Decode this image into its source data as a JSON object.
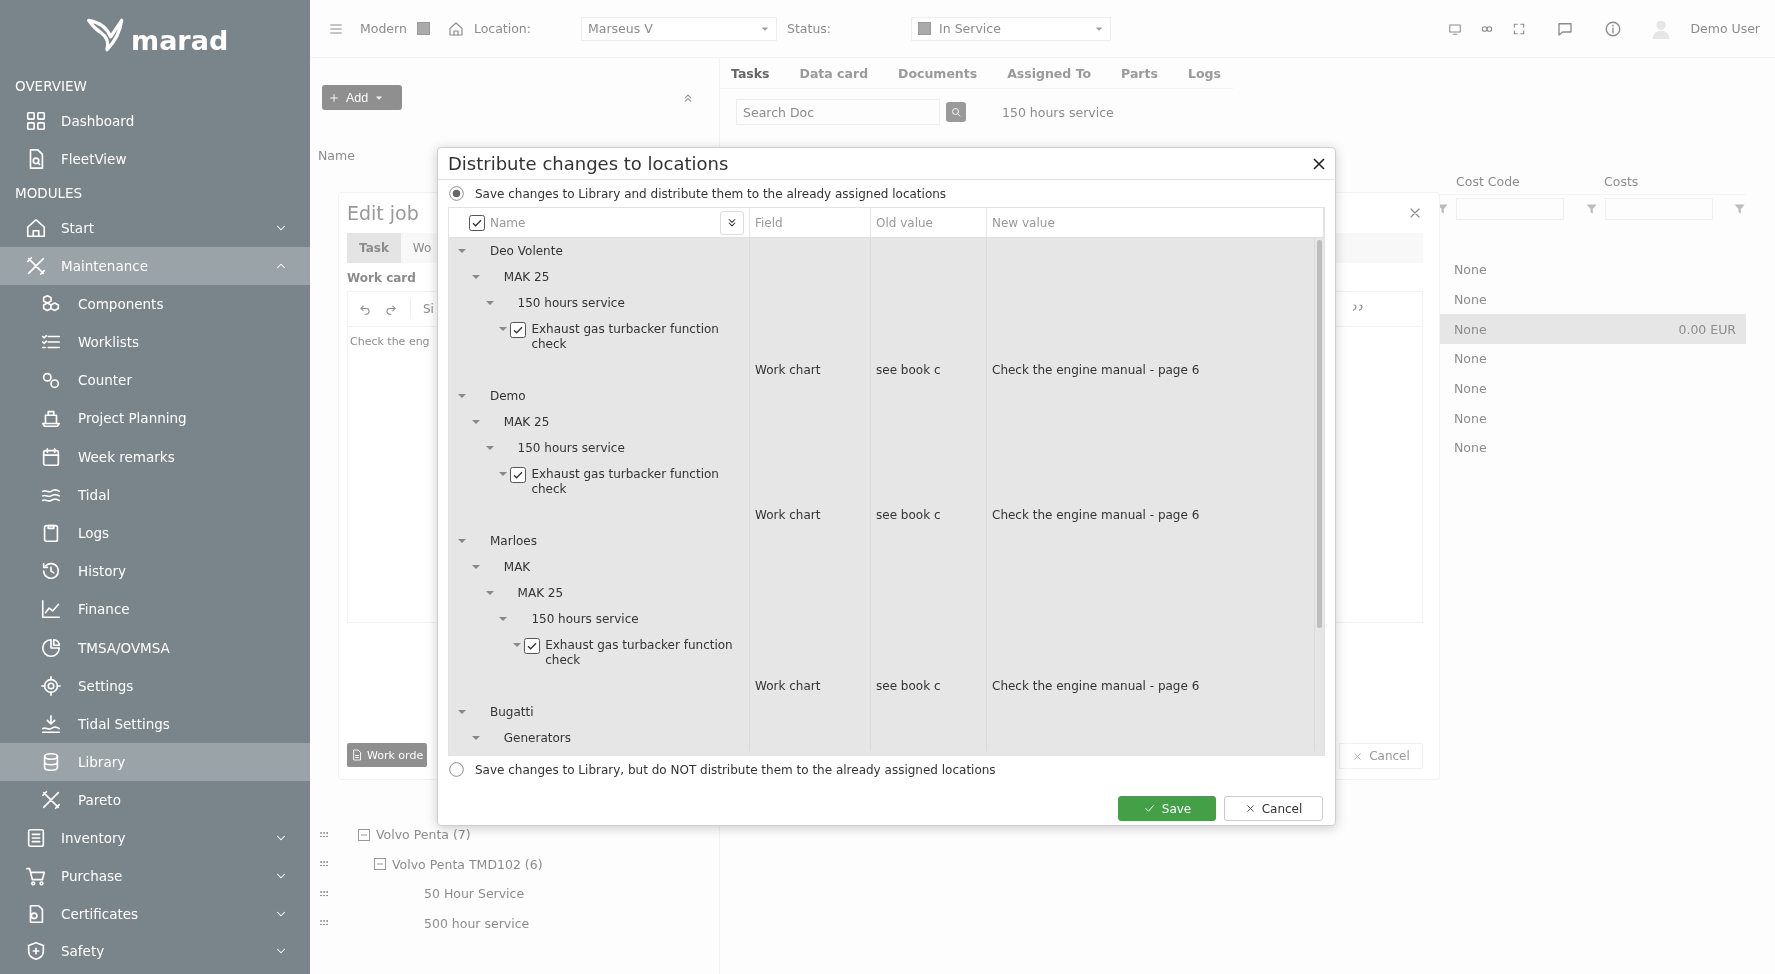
{
  "sidebar": {
    "logo": "marad",
    "sections": [
      {
        "title": "OVERVIEW",
        "items": [
          {
            "label": "Dashboard",
            "selected": false
          },
          {
            "label": "FleetView",
            "selected": false
          }
        ]
      },
      {
        "title": "MODULES",
        "items": [
          {
            "label": "Start",
            "selected": false,
            "expanded": false
          },
          {
            "label": "Maintenance",
            "selected": true,
            "expanded": true,
            "children": [
              {
                "label": "Components",
                "selected": false
              },
              {
                "label": "Worklists",
                "selected": false
              },
              {
                "label": "Counter",
                "selected": false
              },
              {
                "label": "Project Planning",
                "selected": false
              },
              {
                "label": "Week remarks",
                "selected": false
              },
              {
                "label": "Tidal",
                "selected": false
              },
              {
                "label": "Logs",
                "selected": false
              },
              {
                "label": "History",
                "selected": false
              },
              {
                "label": "Finance",
                "selected": false
              },
              {
                "label": "TMSA/OVMSA",
                "selected": false
              },
              {
                "label": "Settings",
                "selected": false
              },
              {
                "label": "Tidal Settings",
                "selected": false
              },
              {
                "label": "Library",
                "selected": true
              },
              {
                "label": "Pareto",
                "selected": false
              }
            ]
          },
          {
            "label": "Inventory",
            "selected": false,
            "expanded": false
          },
          {
            "label": "Purchase",
            "selected": false,
            "expanded": false
          },
          {
            "label": "Certificates",
            "selected": false,
            "expanded": false
          },
          {
            "label": "Safety",
            "selected": false,
            "expanded": false
          }
        ]
      }
    ]
  },
  "topbar": {
    "modern_label": "Modern",
    "modern_checked": true,
    "location_label": "Location:",
    "location_value": "Marseus V",
    "status_label": "Status:",
    "status_value": "In Service",
    "user": "Demo User"
  },
  "left_panel": {
    "add_button": "Add",
    "column": "Name",
    "rows": [
      {
        "label": "Volvo Penta (7)",
        "expanded": true,
        "children": [
          {
            "label": "Volvo Penta TMD102 (6)",
            "expanded": true,
            "children": [
              {
                "label": "50 Hour Service"
              },
              {
                "label": "500 hour service"
              }
            ]
          }
        ]
      }
    ]
  },
  "right_panel": {
    "tabs": [
      {
        "label": "Tasks",
        "selected": true
      },
      {
        "label": "Data card",
        "selected": false
      },
      {
        "label": "Documents",
        "selected": false
      },
      {
        "label": "Assigned To",
        "selected": false
      },
      {
        "label": "Parts",
        "selected": false
      },
      {
        "label": "Logs",
        "selected": false
      }
    ],
    "search_placeholder": "Search Doc",
    "breadcrumb": "150 hours service",
    "columns": [
      "Cost Code",
      "Costs"
    ],
    "rows": [
      {
        "cost_code": "None",
        "selected": false
      },
      {
        "cost_code": "None",
        "selected": false
      },
      {
        "cost_code": "None",
        "costs": "0.00 EUR",
        "selected": true
      },
      {
        "cost_code": "None",
        "selected": false
      },
      {
        "cost_code": "None",
        "selected": false
      },
      {
        "cost_code": "None",
        "selected": false
      },
      {
        "cost_code": "None",
        "selected": false
      }
    ]
  },
  "edit_job": {
    "title": "Edit job",
    "tabs": [
      {
        "label": "Task",
        "selected": true
      },
      {
        "label": "Wo",
        "selected": false
      }
    ],
    "section": "Work card",
    "toolbar_text": "Si",
    "content": "Check the eng",
    "buttons": [
      {
        "label": "Work orde",
        "kind": "work-order"
      },
      {
        "label": "Cancel",
        "kind": "cancel"
      }
    ]
  },
  "dialog": {
    "title": "Distribute changes to locations",
    "options": [
      {
        "label": "Save changes to Library and distribute them to the already assigned locations",
        "selected": true
      },
      {
        "label": "Save changes to Library, but do NOT distribute them to the already assigned locations",
        "selected": false
      }
    ],
    "select_all_checked": true,
    "columns": [
      "Name",
      "Field",
      "Old value",
      "New value"
    ],
    "tree": [
      {
        "name": "Deo Volente",
        "expanded": true,
        "children": [
          {
            "name": "MAK 25",
            "expanded": true,
            "children": [
              {
                "name": "150 hours service",
                "expanded": true,
                "children": [
                  {
                    "name": "Exhaust gas turbacker function check",
                    "expanded": true,
                    "checked": true,
                    "changes": [
                      {
                        "field": "Work chart",
                        "old_value": "see book c",
                        "new_value": "Check the engine manual - page 6"
                      }
                    ]
                  }
                ]
              }
            ]
          }
        ]
      },
      {
        "name": "Demo",
        "expanded": true,
        "children": [
          {
            "name": "MAK 25",
            "expanded": true,
            "children": [
              {
                "name": "150 hours service",
                "expanded": true,
                "children": [
                  {
                    "name": "Exhaust gas turbacker function check",
                    "expanded": true,
                    "checked": true,
                    "changes": [
                      {
                        "field": "Work chart",
                        "old_value": "see book c",
                        "new_value": "Check the engine manual - page 6"
                      }
                    ]
                  }
                ]
              }
            ]
          }
        ]
      },
      {
        "name": "Marloes",
        "expanded": true,
        "children": [
          {
            "name": "MAK",
            "expanded": true,
            "children": [
              {
                "name": "MAK 25",
                "expanded": true,
                "children": [
                  {
                    "name": "150 hours service",
                    "expanded": true,
                    "children": [
                      {
                        "name": "Exhaust gas turbacker function check",
                        "expanded": true,
                        "checked": true,
                        "changes": [
                          {
                            "field": "Work chart",
                            "old_value": "see book c",
                            "new_value": "Check the engine manual - page 6"
                          }
                        ]
                      }
                    ]
                  }
                ]
              }
            ]
          }
        ]
      },
      {
        "name": "Bugatti",
        "expanded": true,
        "children": [
          {
            "name": "Generators",
            "expanded": true
          }
        ]
      }
    ],
    "buttons": [
      {
        "label": "Save",
        "kind": "primary"
      },
      {
        "label": "Cancel",
        "kind": "secondary"
      }
    ]
  }
}
